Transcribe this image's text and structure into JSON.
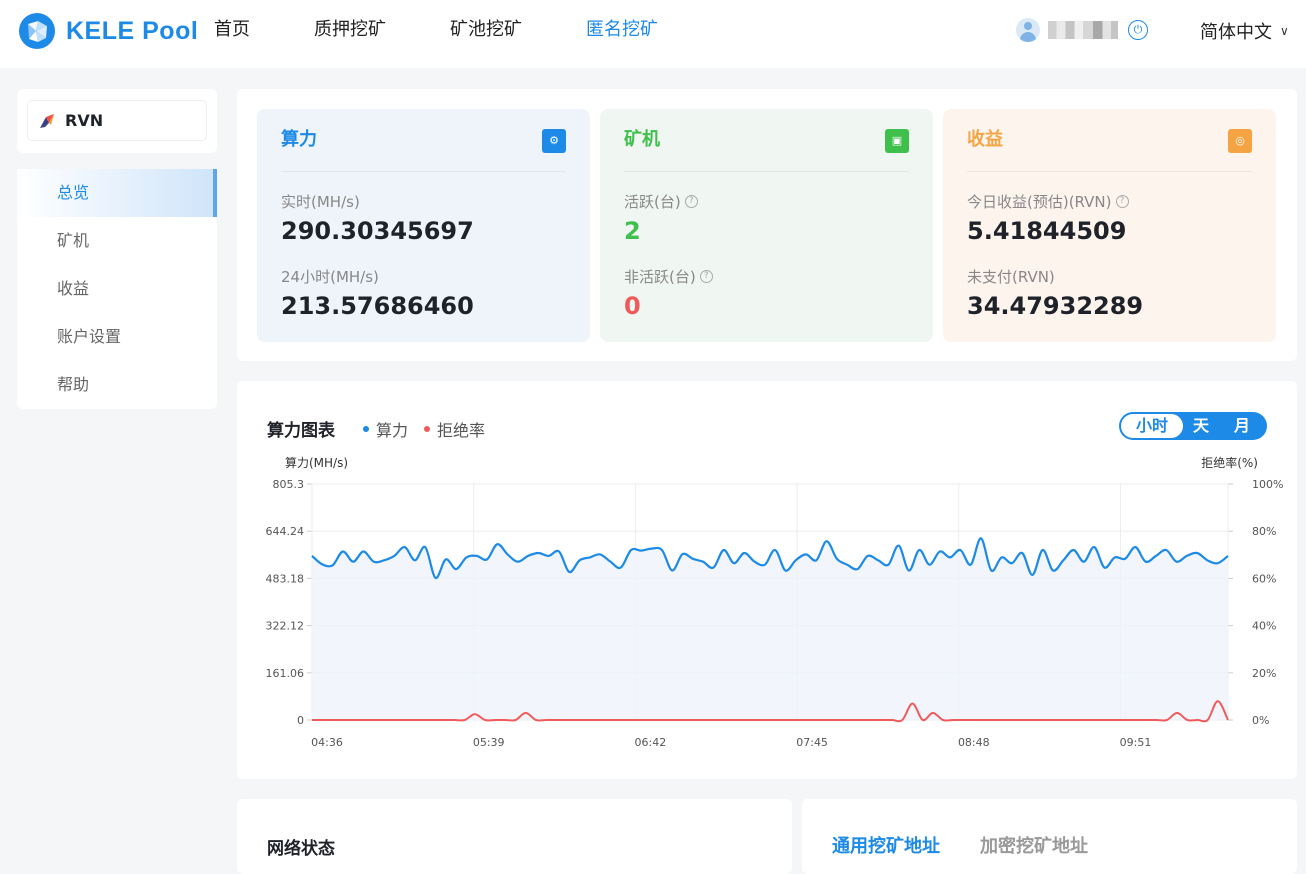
{
  "header": {
    "logo_text": "KELE Pool",
    "nav": [
      "首页",
      "质押挖矿",
      "矿池挖矿",
      "匿名挖矿"
    ],
    "active_nav": "匿名挖矿",
    "language": "简体中文"
  },
  "sidebar": {
    "coin": "RVN",
    "menu": [
      "总览",
      "矿机",
      "收益",
      "账户设置",
      "帮助"
    ],
    "active": "总览"
  },
  "stats": {
    "hashrate": {
      "title": "算力",
      "realtime_label": "实时(MH/s)",
      "realtime_value": "290.30345697",
      "h24_label": "24小时(MH/s)",
      "h24_value": "213.57686460"
    },
    "miners": {
      "title": "矿机",
      "active_label": "活跃(台)",
      "active_value": "2",
      "inactive_label": "非活跃(台)",
      "inactive_value": "0"
    },
    "earnings": {
      "title": "收益",
      "today_label": "今日收益(预估)(RVN)",
      "today_value": "5.41844509",
      "unpaid_label": "未支付(RVN)",
      "unpaid_value": "34.47932289"
    }
  },
  "chart_panel": {
    "title": "算力图表",
    "toggle": [
      "小时",
      "天",
      "月"
    ],
    "toggle_active": "小时"
  },
  "colors": {
    "accent": "#1c8ae6",
    "green": "#3fbf4b",
    "orange": "#f5a443",
    "red": "#f05a5a"
  },
  "chart_data": {
    "type": "line",
    "ylabel": "算力(MH/s)",
    "y2label": "拒绝率(%)",
    "ylim": [
      0,
      805.3
    ],
    "y_ticks": [
      "0",
      "161.06",
      "322.12",
      "483.18",
      "644.24",
      "805.3"
    ],
    "y2lim": [
      0,
      100
    ],
    "y2_ticks": [
      "0%",
      "20%",
      "40%",
      "60%",
      "80%",
      "100%"
    ],
    "x_ticks": [
      "04:36",
      "05:39",
      "06:42",
      "07:45",
      "08:48",
      "09:51"
    ],
    "grid": true,
    "legend": "top-left",
    "series": [
      {
        "name": "算力",
        "color": "#1c8ae6",
        "area": true,
        "values": [
          560,
          531,
          528,
          575,
          540,
          575,
          540,
          545,
          560,
          590,
          545,
          590,
          485,
          548,
          515,
          555,
          560,
          548,
          600,
          565,
          540,
          560,
          570,
          560,
          575,
          505,
          545,
          555,
          565,
          540,
          520,
          580,
          578,
          585,
          580,
          510,
          566,
          550,
          540,
          520,
          580,
          535,
          570,
          540,
          530,
          580,
          510,
          545,
          565,
          545,
          610,
          550,
          530,
          515,
          560,
          545,
          530,
          595,
          510,
          580,
          530,
          575,
          555,
          580,
          530,
          620,
          510,
          555,
          535,
          570,
          495,
          580,
          510,
          545,
          580,
          540,
          590,
          520,
          555,
          550,
          590,
          540,
          560,
          580,
          540,
          560,
          570,
          545,
          535,
          560
        ]
      },
      {
        "name": "拒绝率",
        "color": "#f05a5a",
        "values": [
          0,
          0,
          0,
          0,
          0,
          0,
          0,
          0,
          0,
          0,
          0,
          0,
          0,
          0,
          0,
          0,
          2.5,
          0,
          0,
          0,
          0,
          3,
          0,
          0,
          0,
          0,
          0,
          0,
          0,
          0,
          0,
          0,
          0,
          0,
          0,
          0,
          0,
          0,
          0,
          0,
          0,
          0,
          0,
          0,
          0,
          0,
          0,
          0,
          0,
          0,
          0,
          0,
          0,
          0,
          0,
          0,
          0,
          0,
          0,
          7,
          0,
          3,
          0,
          0,
          0,
          0,
          0,
          0,
          0,
          0,
          0,
          0,
          0,
          0,
          0,
          0,
          0,
          0,
          0,
          0,
          0,
          0,
          0,
          0,
          0,
          3,
          0,
          0,
          0,
          8,
          0
        ]
      }
    ]
  },
  "network": {
    "title": "网络状态"
  },
  "address": {
    "tab1": "通用挖矿地址",
    "tab2": "加密挖矿地址"
  }
}
